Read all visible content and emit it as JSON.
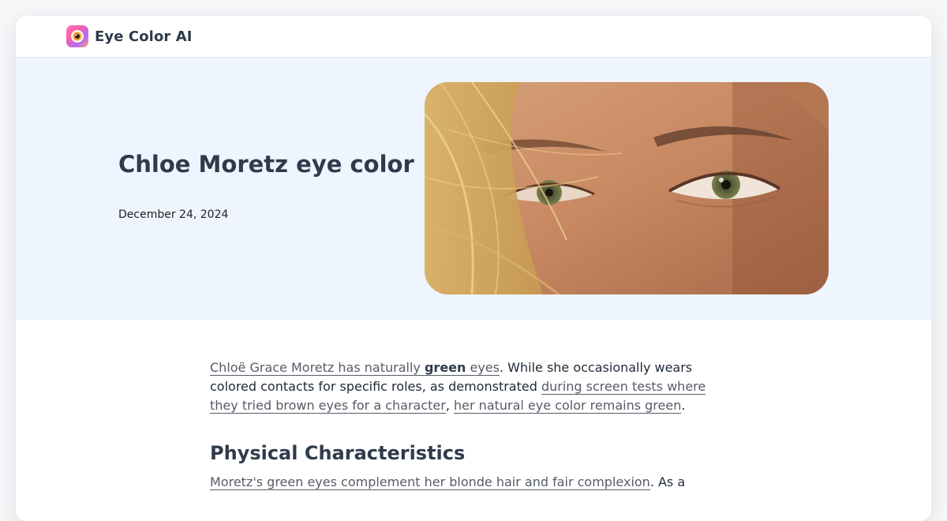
{
  "app": {
    "name": "Eye Color AI",
    "logo_icon": "eye-logo-icon"
  },
  "hero": {
    "title": "Chloe Moretz eye color",
    "date": "December 24, 2024",
    "image_icon": "eye-closeup-photo",
    "eye_color": "#6f7846"
  },
  "article": {
    "intro": {
      "link1_pre": "Chloë Grace Moretz has naturally ",
      "link1_bold": "green",
      "link1_post": " eyes",
      "text1": ". While she occasionally wears colored contacts for specific roles, as demonstrated ",
      "link2": "during screen tests where they tried brown eyes for a character",
      "text2": ", ",
      "link3": "her natural eye color remains green",
      "text3": "."
    },
    "section_heading": "Physical Characteristics",
    "section_p": {
      "link1": "Moretz's green eyes complement her blonde hair and fair complexion",
      "text1": ". As a"
    }
  },
  "colors": {
    "hero_bg": "#eef5ff",
    "heading": "#2f3b4c",
    "link": "#555b66"
  }
}
